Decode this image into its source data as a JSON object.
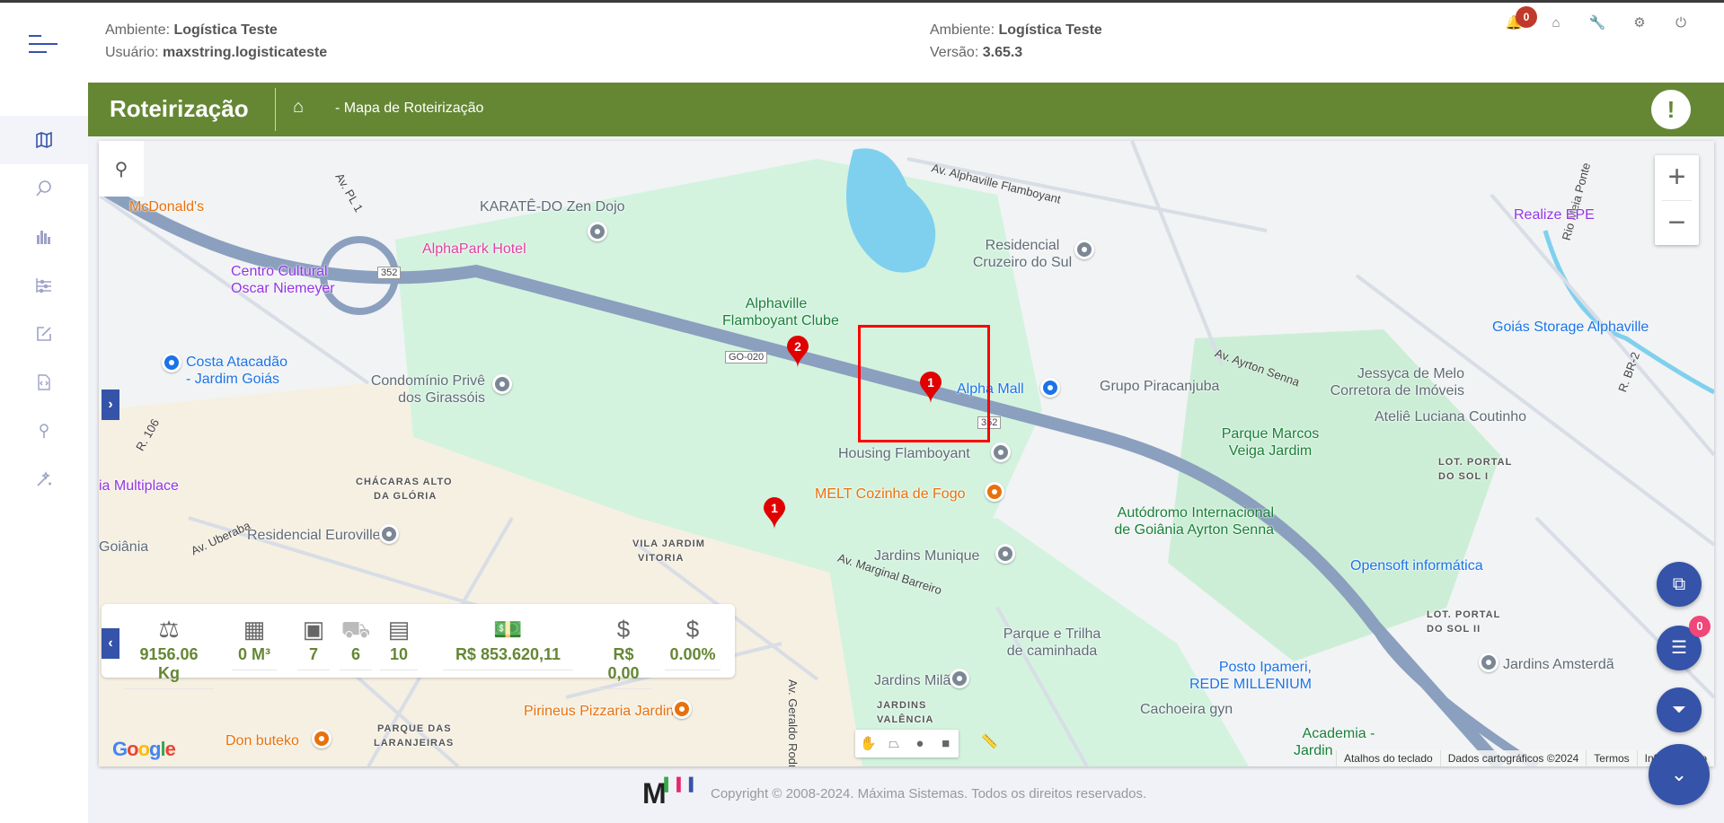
{
  "header": {
    "left": {
      "env_label": "Ambiente:",
      "env_value": "Logística Teste",
      "user_label": "Usuário:",
      "user_value": "maxstring.logisticateste"
    },
    "right": {
      "env_label": "Ambiente:",
      "env_value": "Logística Teste",
      "version_label": "Versão:",
      "version_value": "3.65.3"
    },
    "notification_count": "0",
    "icons": [
      "bell-icon",
      "home-icon",
      "wrench-icon",
      "gear-icon",
      "logout-icon"
    ]
  },
  "page": {
    "title": "Roteirização",
    "breadcrumb": "- Mapa de Roteirização",
    "alert_symbol": "!"
  },
  "sidebar": {
    "items": [
      "map-icon",
      "search-icon",
      "bar-chart-icon",
      "filters-icon",
      "edit-icon",
      "code-file-icon",
      "pin-icon",
      "magic-wand-icon"
    ],
    "active": 0
  },
  "map": {
    "labels": [
      "McDonald's",
      "KARATÊ-DO Zen Dojo",
      "AlphaPark Hotel",
      "Centro Cultural",
      "Oscar Niemeyer",
      "Costa Atacadão",
      "- Jardim Goiás",
      "Condomínio Privê",
      "dos Girassóis",
      "Alphaville",
      "Flamboyant Clube",
      "Residencial",
      "Cruzeiro do Sul",
      "Realize EPE",
      "Goiás Storage Alphaville",
      "Alpha Mall",
      "Grupo Piracanjuba",
      "Jessyca de Melo",
      "Corretora de Imóveis",
      "Ateliê Luciana Coutinho",
      "Housing Flamboyant",
      "MELT Cozinha de Fogo",
      "Parque Marcos",
      "Veiga Jardim",
      "CHÁCARAS ALTO",
      "DA GLÓRIA",
      "ia Multiplace",
      "Autódromo Internacional",
      "de Goiânia Ayrton Senna",
      "LOT. PORTAL",
      "DO SOL I",
      "Residencial Euroville II",
      "VILA JARDIM",
      "VITORIA",
      "Jardins Munique",
      "Opensoft informática",
      "Goiânia",
      "LOT. PORTAL",
      "DO SOL II",
      "Parque e Trilha",
      "de caminhada",
      "Posto Ipameri,",
      "REDE MILLENIUM",
      "Jardins Amsterdã",
      "Jardins Milão",
      "JARDINS",
      "VALÊNCIA",
      "Cachoeira gyn",
      "Pirineus Pizzaria Jardins",
      "Don buteko",
      "PARQUE DAS",
      "LARANJEIRAS",
      "Academia -",
      "Jardin"
    ],
    "roads": [
      "Av. Alphaville Flamboyant",
      "Av. Ayrton Senna",
      "Av. Marginal Barreiro",
      "Av. Geraldo Rodrigues",
      "GO-020",
      "352",
      "352",
      "Av. PL 1",
      "R. 106",
      "Av. Uberaba",
      "Rio Meia Ponte",
      "R. BR-2"
    ],
    "markers": [
      {
        "label": "2"
      },
      {
        "label": "1"
      },
      {
        "label": "1"
      }
    ],
    "marker_color": "#e00000",
    "zoom_in": "+",
    "zoom_out": "−",
    "attribution": [
      "Atalhos do teclado",
      "Dados cartográficos ©2024",
      "Termos",
      "Informar erro"
    ],
    "google_logo": "Google",
    "draw_tools": [
      "hand-icon",
      "polygon-icon",
      "circle-icon",
      "rectangle-icon",
      "ruler-icon"
    ]
  },
  "stats": [
    {
      "icon": "weight-icon",
      "value": "9156.06  Kg"
    },
    {
      "icon": "cubes-icon",
      "value": "0  M³"
    },
    {
      "icon": "box-icon",
      "value": "7"
    },
    {
      "icon": "truck-icon",
      "value": "6"
    },
    {
      "icon": "boxes-icon",
      "value": "10"
    },
    {
      "icon": "money-icon",
      "value": "R$ 853.620,11"
    },
    {
      "icon": "coin-icon",
      "value": "R$ 0,00"
    },
    {
      "icon": "coin-percent-icon",
      "value": "0.00%"
    }
  ],
  "fabs": {
    "list_badge": "0",
    "icons": [
      "select-area-icon",
      "list-icon",
      "filter-icon",
      "chevron-down-icon"
    ]
  },
  "footer": {
    "logo": "M",
    "text": "Copyright © 2008-2024. Máxima Sistemas. Todos os direitos reservados."
  },
  "colors": {
    "primary": "#3553a8",
    "header_green": "#658734",
    "stat_green": "#658734",
    "badge_red": "#c0392b"
  }
}
